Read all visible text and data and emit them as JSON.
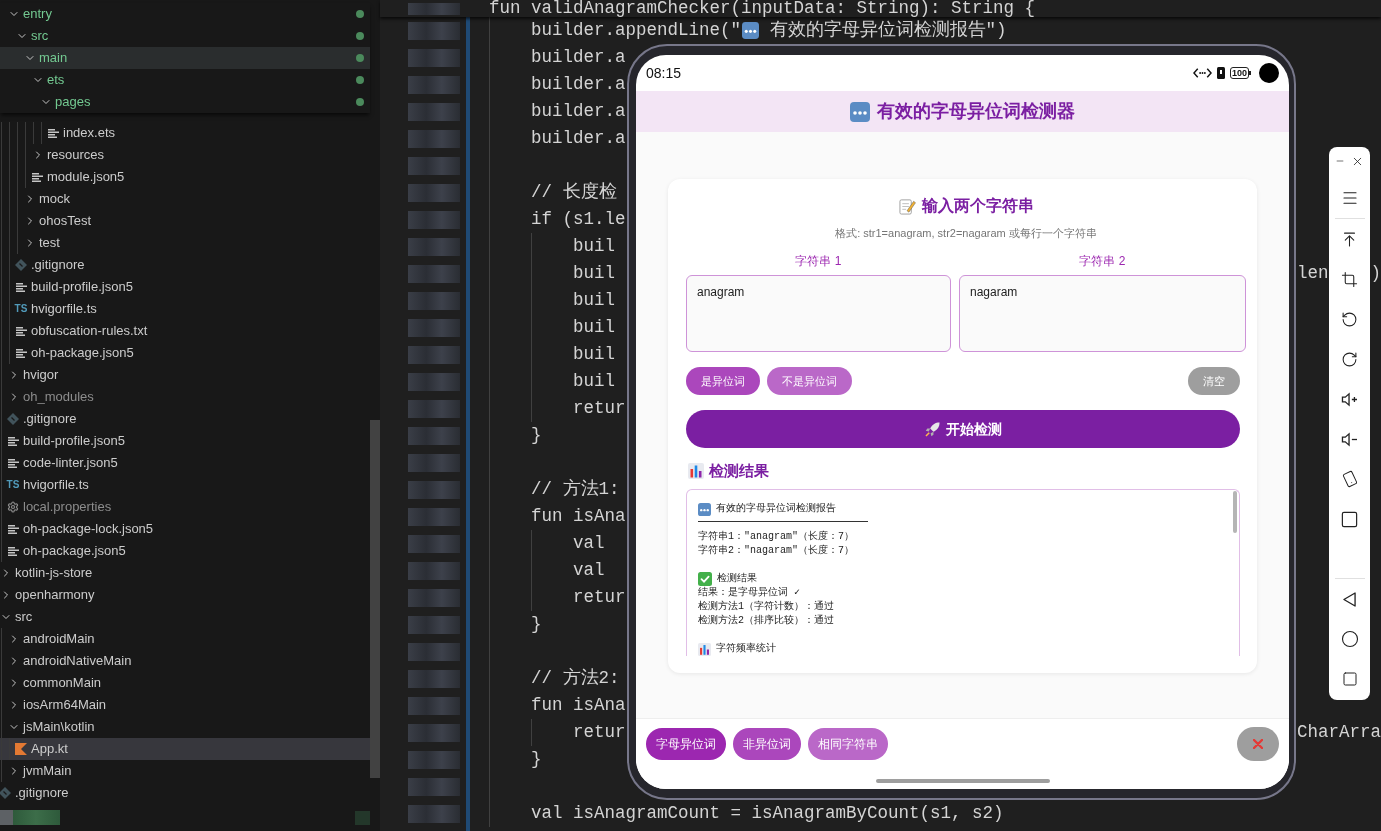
{
  "explorer": {
    "folder_contents": [
      {
        "label": "entry",
        "kind": "folder",
        "expanded": true,
        "modified": true,
        "ignored": false,
        "selected": false,
        "hovered": false,
        "children": [
          {
            "label": "src",
            "kind": "folder",
            "expanded": true,
            "modified": true,
            "ignored": false,
            "selected": false,
            "hovered": false,
            "children": [
              {
                "label": "main",
                "kind": "folder",
                "expanded": true,
                "modified": true,
                "ignored": false,
                "selected": false,
                "hovered": true,
                "children": [
                  {
                    "label": "ets",
                    "kind": "folder",
                    "expanded": true,
                    "modified": true,
                    "ignored": false,
                    "selected": false,
                    "hovered": false,
                    "children": [
                      {
                        "label": "pages",
                        "kind": "folder",
                        "expanded": true,
                        "modified": true,
                        "ignored": false,
                        "selected": false,
                        "hovered": false,
                        "children": [
                          {
                            "label": "index.ets",
                            "kind": "file",
                            "modified": false,
                            "ignored": false,
                            "selected": false,
                            "hovered": false
                          }
                        ]
                      }
                    ]
                  },
                  {
                    "label": "resources",
                    "kind": "folder",
                    "expanded": false,
                    "modified": false,
                    "ignored": false,
                    "selected": false,
                    "hovered": false
                  },
                  {
                    "label": "module.json5",
                    "kind": "file",
                    "modified": false,
                    "ignored": false,
                    "selected": false,
                    "hovered": false
                  }
                ]
              },
              {
                "label": "mock",
                "kind": "folder",
                "expanded": false,
                "modified": false,
                "ignored": false,
                "selected": false,
                "hovered": false
              },
              {
                "label": "ohosTest",
                "kind": "folder",
                "expanded": false,
                "modified": false,
                "ignored": false,
                "selected": false,
                "hovered": false
              },
              {
                "label": "test",
                "kind": "folder",
                "expanded": false,
                "modified": false,
                "ignored": false,
                "selected": false,
                "hovered": false
              }
            ]
          },
          {
            "label": ".gitignore",
            "kind": "git",
            "modified": false,
            "ignored": false,
            "selected": false,
            "hovered": false
          },
          {
            "label": "build-profile.json5",
            "kind": "file",
            "modified": false,
            "ignored": false,
            "selected": false,
            "hovered": false
          },
          {
            "label": "hvigorfile.ts",
            "kind": "script",
            "badge": "TS",
            "modified": false,
            "ignored": false,
            "selected": false,
            "hovered": false
          },
          {
            "label": "obfuscation-rules.txt",
            "kind": "file",
            "modified": false,
            "ignored": false,
            "selected": false,
            "hovered": false
          },
          {
            "label": "oh-package.json5",
            "kind": "file",
            "modified": false,
            "ignored": false,
            "selected": false,
            "hovered": false
          }
        ]
      },
      {
        "label": "hvigor",
        "kind": "folder",
        "expanded": false,
        "modified": false,
        "ignored": false,
        "selected": false,
        "hovered": false
      },
      {
        "label": "oh_modules",
        "kind": "folder",
        "expanded": false,
        "modified": false,
        "ignored": true,
        "selected": false,
        "hovered": false
      },
      {
        "label": ".gitignore",
        "kind": "git",
        "modified": false,
        "ignored": false,
        "selected": false,
        "hovered": false
      },
      {
        "label": "build-profile.json5",
        "kind": "file",
        "modified": false,
        "ignored": false,
        "selected": false,
        "hovered": false
      },
      {
        "label": "code-linter.json5",
        "kind": "file",
        "modified": false,
        "ignored": false,
        "selected": false,
        "hovered": false
      },
      {
        "label": "hvigorfile.ts",
        "kind": "script",
        "badge": "TS",
        "modified": false,
        "ignored": false,
        "selected": false,
        "hovered": false
      },
      {
        "label": "local.properties",
        "kind": "settings",
        "modified": false,
        "ignored": true,
        "selected": false,
        "hovered": false
      },
      {
        "label": "oh-package-lock.json5",
        "kind": "file",
        "modified": false,
        "ignored": false,
        "selected": false,
        "hovered": false
      },
      {
        "label": "oh-package.json5",
        "kind": "file",
        "modified": false,
        "ignored": false,
        "selected": false,
        "hovered": false
      }
    ],
    "tree": [
      {
        "label": "kotlin-js-store",
        "kind": "folder",
        "expanded": false,
        "modified": false,
        "ignored": false,
        "selected": false,
        "hovered": false
      },
      {
        "label": "openharmony",
        "kind": "folder",
        "expanded": false,
        "modified": false,
        "ignored": false,
        "selected": false,
        "hovered": false
      },
      {
        "label": "src",
        "kind": "folder",
        "expanded": true,
        "modified": false,
        "ignored": false,
        "selected": false,
        "hovered": false,
        "children": [
          {
            "label": "androidMain",
            "kind": "folder",
            "expanded": false,
            "modified": false,
            "ignored": false,
            "selected": false,
            "hovered": false
          },
          {
            "label": "androidNativeMain",
            "kind": "folder",
            "expanded": false,
            "modified": false,
            "ignored": false,
            "selected": false,
            "hovered": false
          },
          {
            "label": "commonMain",
            "kind": "folder",
            "expanded": false,
            "modified": false,
            "ignored": false,
            "selected": false,
            "hovered": false
          },
          {
            "label": "iosArm64Main",
            "kind": "folder",
            "expanded": false,
            "modified": false,
            "ignored": false,
            "selected": false,
            "hovered": false
          },
          {
            "label": "jsMain\\kotlin",
            "kind": "folder",
            "expanded": true,
            "modified": false,
            "ignored": false,
            "selected": false,
            "hovered": false,
            "children": [
              {
                "label": "App.kt",
                "kind": "kotlin",
                "modified": false,
                "ignored": false,
                "selected": true,
                "hovered": false
              }
            ]
          },
          {
            "label": "jvmMain",
            "kind": "folder",
            "expanded": false,
            "modified": false,
            "ignored": false,
            "selected": false,
            "hovered": false
          }
        ]
      },
      {
        "label": ".gitignore",
        "kind": "git",
        "modified": false,
        "ignored": false,
        "selected": false,
        "hovered": false
      }
    ]
  },
  "editor": {
    "sticky_line": "fun validAnagramChecker(inputData: String): String {",
    "lines": [
      {
        "kind": "emoji",
        "text": "    builder.appendLine(\"",
        "after": " 有效的字母异位词检测报告\")"
      },
      {
        "kind": "text",
        "text": "    builder.a"
      },
      {
        "kind": "text",
        "text": "    builder.a"
      },
      {
        "kind": "text",
        "text": "    builder.a"
      },
      {
        "kind": "text",
        "text": "    builder.a"
      },
      {
        "kind": "blank"
      },
      {
        "kind": "text",
        "text": "    // 长度检"
      },
      {
        "kind": "text",
        "text": "    if (s1.le"
      },
      {
        "kind": "text",
        "text": "        buil"
      },
      {
        "kind": "text",
        "text": "        buil",
        "right": "len",
        "edge": ")"
      },
      {
        "kind": "text",
        "text": "        buil"
      },
      {
        "kind": "text",
        "text": "        buil"
      },
      {
        "kind": "text",
        "text": "        buil"
      },
      {
        "kind": "text",
        "text": "        buil"
      },
      {
        "kind": "text",
        "text": "        retur"
      },
      {
        "kind": "text",
        "text": "    }"
      },
      {
        "kind": "blank"
      },
      {
        "kind": "text",
        "text": "    // 方法1:"
      },
      {
        "kind": "text",
        "text": "    fun isAna"
      },
      {
        "kind": "text",
        "text": "        val"
      },
      {
        "kind": "text",
        "text": "        val"
      },
      {
        "kind": "text",
        "text": "        retur"
      },
      {
        "kind": "text",
        "text": "    }"
      },
      {
        "kind": "blank"
      },
      {
        "kind": "text",
        "text": "    // 方法2:"
      },
      {
        "kind": "text",
        "text": "    fun isAna"
      },
      {
        "kind": "text",
        "text": "        retur",
        "right": "CharArra"
      },
      {
        "kind": "text",
        "text": "    }"
      },
      {
        "kind": "blank"
      },
      {
        "kind": "text",
        "text": "    val isAnagramCount = isAnagramByCount(s1, s2)"
      }
    ]
  },
  "emulator": {
    "status_bar": {
      "time": "08:15",
      "battery": "100"
    },
    "app_bar": {
      "title": "有效的字母异位词检测器"
    },
    "input_card": {
      "title": "输入两个字符串",
      "hint": "格式: str1=anagram, str2=nagaram 或每行一个字符串",
      "fields": [
        {
          "label": "字符串 1",
          "value": "anagram"
        },
        {
          "label": "字符串 2",
          "value": "nagaram"
        }
      ],
      "quick_buttons": [
        {
          "label": "是异位词",
          "color": "#ab47bc"
        },
        {
          "label": "不是异位词",
          "color": "#ba68c8"
        }
      ],
      "clear_button": "清空",
      "submit_button": "开始检测"
    },
    "results": {
      "title": "检测结果",
      "lines": [
        {
          "kind": "title",
          "text": "有效的字母异位词检测报告"
        },
        {
          "kind": "rule"
        },
        {
          "kind": "line",
          "text": "字符串1：\"anagram\"（长度：7）"
        },
        {
          "kind": "line",
          "text": "字符串2：\"nagaram\"（长度：7）"
        },
        {
          "kind": "blank"
        },
        {
          "kind": "success",
          "text": "检测结果"
        },
        {
          "kind": "line",
          "text": "结果：是字母异位词 ✓"
        },
        {
          "kind": "line",
          "text": "检测方法1（字符计数）：通过"
        },
        {
          "kind": "line",
          "text": "检测方法2（排序比较）：通过"
        },
        {
          "kind": "blank"
        },
        {
          "kind": "stats",
          "text": "字符频率统计"
        }
      ]
    },
    "presets": [
      {
        "label": "字母异位词",
        "color": "#9c27b0"
      },
      {
        "label": "非异位词",
        "color": "#ab47bc"
      },
      {
        "label": "相同字符串",
        "color": "#ba68c8"
      }
    ]
  }
}
